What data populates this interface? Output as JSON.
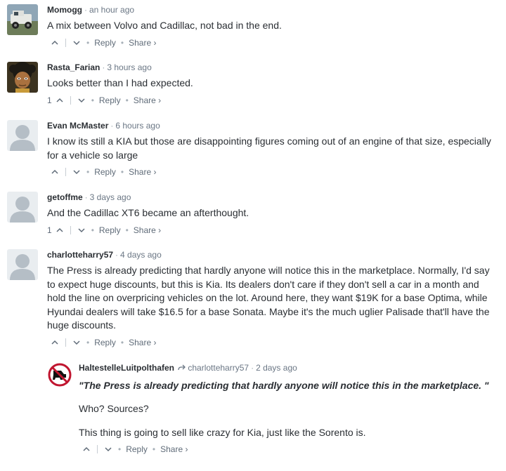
{
  "comments": [
    {
      "author": "Momogg",
      "time": "an hour ago",
      "text": "A mix between Volvo and Cadillac, not bad in the end.",
      "upvotes": "",
      "reply_label": "Reply",
      "share_label": "Share ›",
      "avatar_icon": "jeep-photo-avatar"
    },
    {
      "author": "Rasta_Farian",
      "time": "3 hours ago",
      "text": "Looks better than I had expected.",
      "upvotes": "1",
      "reply_label": "Reply",
      "share_label": "Share ›",
      "avatar_icon": "cartoon-avatar"
    },
    {
      "author": "Evan McMaster",
      "time": "6 hours ago",
      "text": "I know its still a KIA but those are disappointing figures coming out of an engine of that size, especially for a vehicle so large",
      "upvotes": "",
      "reply_label": "Reply",
      "share_label": "Share ›",
      "avatar_icon": "default-user-avatar"
    },
    {
      "author": "getoffme",
      "time": "3 days ago",
      "text": "And the Cadillac XT6 became an afterthought.",
      "upvotes": "1",
      "reply_label": "Reply",
      "share_label": "Share ›",
      "avatar_icon": "default-user-avatar"
    },
    {
      "author": "charlotteharry57",
      "time": "4 days ago",
      "text": "The Press is already predicting that hardly anyone will notice this in the marketplace. Normally, I'd say to expect huge discounts, but this is Kia. Its dealers don't care if they don't sell a car in a month and hold the line on overpricing vehicles on the lot. Around here, they want $19K for a base Optima, while Hyundai dealers will take $16.5 for a base Sonata. Maybe it's the much uglier Palisade that'll have the huge discounts.",
      "upvotes": "",
      "reply_label": "Reply",
      "share_label": "Share ›",
      "avatar_icon": "default-user-avatar"
    }
  ],
  "reply": {
    "author": "HaltestelleLuitpolthafen",
    "in_reply_to": "charlotteharry57",
    "time": "2 days ago",
    "quote": "\"The Press is already predicting that hardly anyone will notice this in the marketplace. \"",
    "para1": "Who? Sources?",
    "para2": "This thing is going to sell like crazy for Kia, just like the Sorento is.",
    "upvotes": "",
    "reply_label": "Reply",
    "share_label": "Share ›",
    "avatar_icon": "no-entry-sign-avatar"
  },
  "colors": {
    "text": "#2a2e33",
    "meta": "#6b7785",
    "avatar_grey": "#b5bec6",
    "no_entry_red": "#c0152f"
  }
}
